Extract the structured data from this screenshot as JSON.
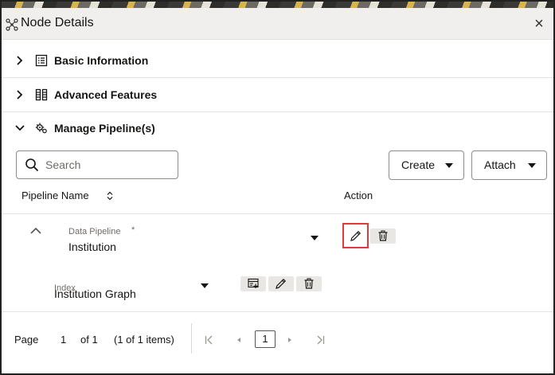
{
  "dialog": {
    "title": "Node Details",
    "close_glyph": "×"
  },
  "sections": [
    {
      "label": "Basic Information",
      "icon": "list-icon",
      "expanded": false
    },
    {
      "label": "Advanced Features",
      "icon": "columns-icon",
      "expanded": false
    },
    {
      "label": "Manage Pipeline(s)",
      "icon": "gears-icon",
      "expanded": true
    }
  ],
  "toolbar": {
    "search_placeholder": "Search",
    "create_label": "Create",
    "attach_label": "Attach"
  },
  "table": {
    "columns": [
      "Pipeline Name",
      "Action"
    ],
    "row": {
      "pipeline_label": "Data Pipeline",
      "required_marker": "*",
      "pipeline_value": "Institution",
      "index_label": "Index",
      "index_value": "Institution Graph"
    }
  },
  "pagination": {
    "page_label": "Page",
    "current_page": "1",
    "of_label": "of 1",
    "items_summary": "(1 of 1 items)",
    "page_box": "1"
  },
  "colors": {
    "highlight": "#e03a3a",
    "header_bg": "#f1efed",
    "icon_button_bg": "#e9e7e4"
  }
}
